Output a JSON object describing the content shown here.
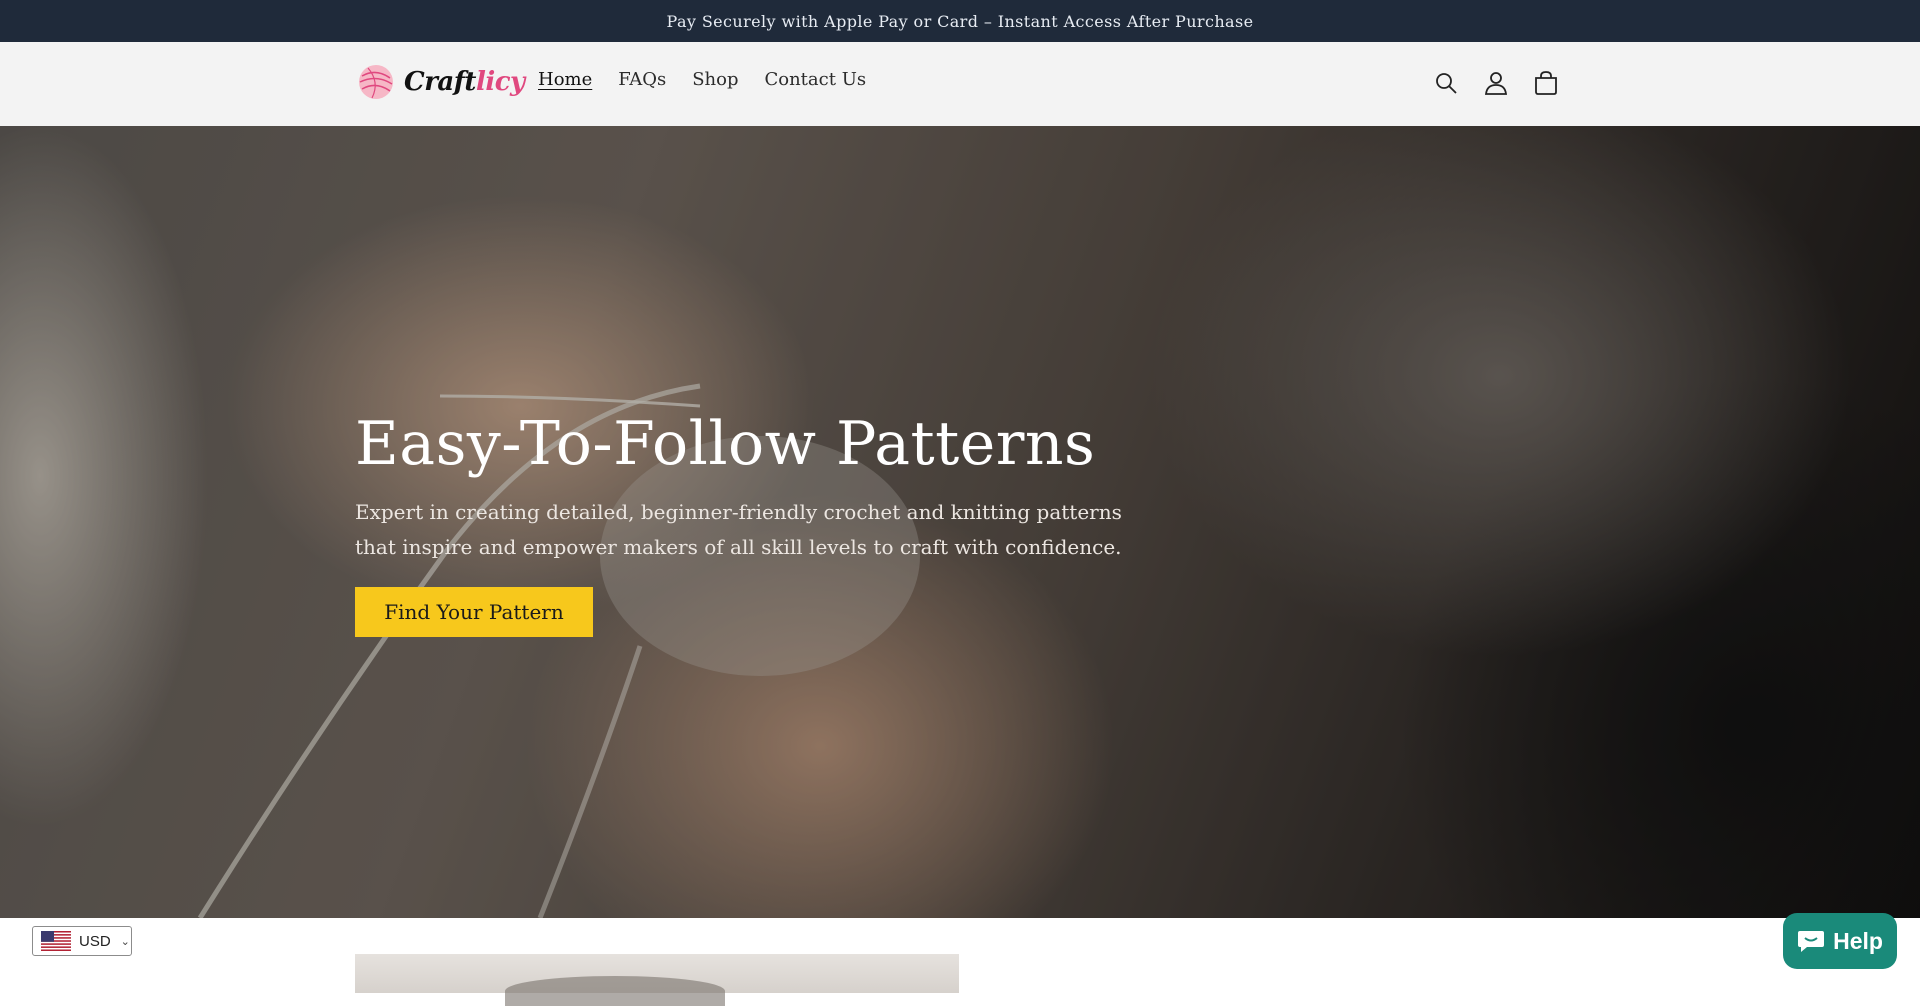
{
  "announcement": {
    "text": "Pay Securely with Apple Pay or Card – Instant Access After Purchase"
  },
  "header": {
    "logo": {
      "brand_dark": "Craft",
      "brand_accent": "licy",
      "icon": "yarn-ball-icon"
    },
    "nav": [
      {
        "label": "Home",
        "active": true
      },
      {
        "label": "FAQs",
        "active": false
      },
      {
        "label": "Shop",
        "active": false
      },
      {
        "label": "Contact Us",
        "active": false
      }
    ],
    "icons": [
      "search-icon",
      "account-icon",
      "cart-icon"
    ]
  },
  "hero": {
    "title": "Easy-To-Follow Patterns",
    "subtitle": "Expert in creating detailed, beginner-friendly crochet and knitting patterns that inspire and empower makers of all skill levels to craft with confidence.",
    "cta_label": "Find Your Pattern",
    "cta_color": "#f7c81c"
  },
  "currency": {
    "code": "USD",
    "flag_icon": "us-flag-icon"
  },
  "help": {
    "label": "Help",
    "color": "#1a8a7a",
    "icon": "chat-icon"
  },
  "colors": {
    "announcement_bg": "#1f2a3a",
    "header_bg": "#f3f3f3",
    "accent_pink": "#e0487f"
  }
}
